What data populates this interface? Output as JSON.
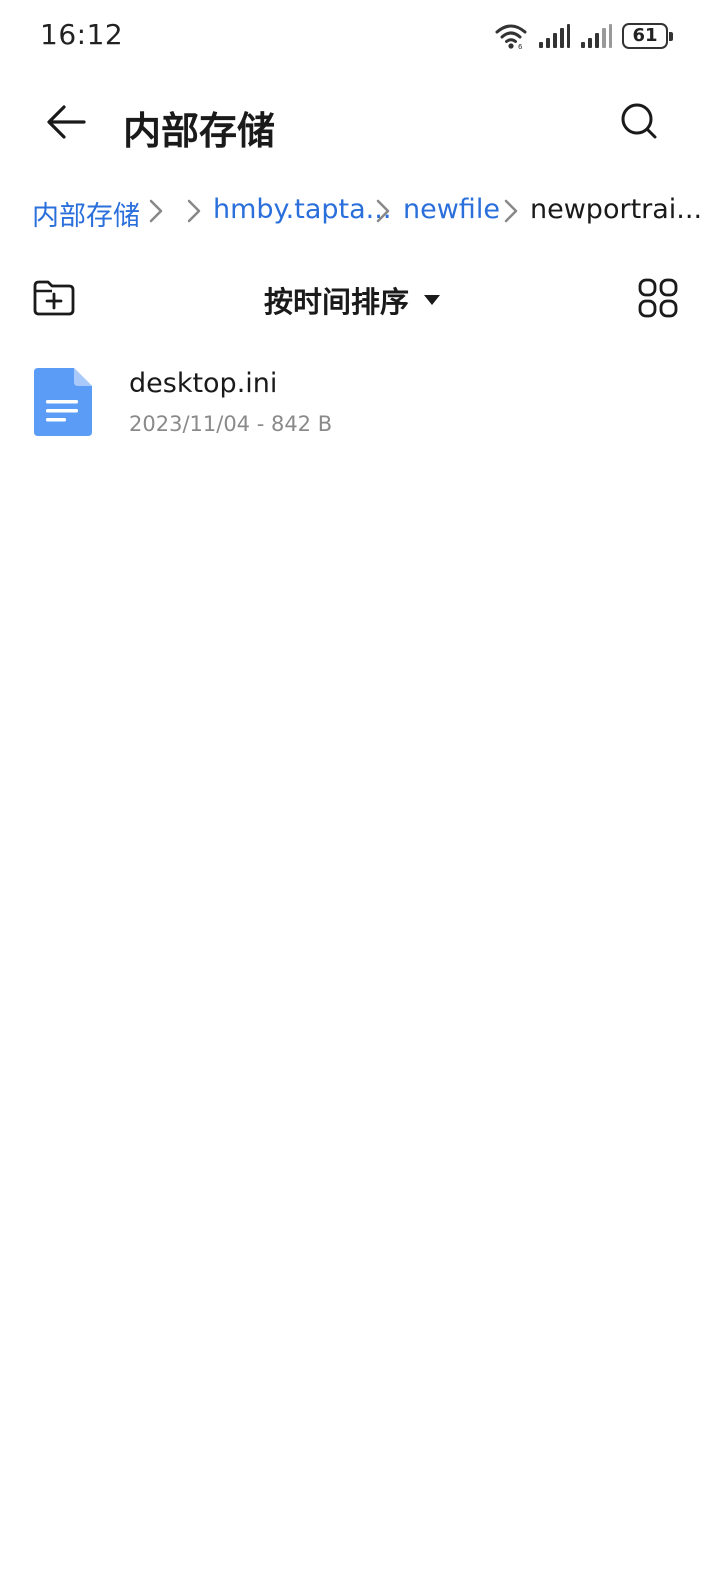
{
  "status_bar": {
    "time": "16:12",
    "battery": "61",
    "icons": [
      "wifi-icon",
      "signal-icon",
      "signal-icon",
      "battery-icon"
    ]
  },
  "header": {
    "title": "内部存储",
    "back_icon": "arrow-left-icon",
    "search_icon": "search-icon"
  },
  "breadcrumb": {
    "items": [
      {
        "label": "内部存储",
        "state": "link"
      },
      {
        "label": "hmby.tapta...",
        "state": "link"
      },
      {
        "label": "newfile",
        "state": "link"
      },
      {
        "label": "newportrai...",
        "state": "current"
      }
    ],
    "separator_icon": "chevron-right-icon",
    "link_color": "#2a6fdb"
  },
  "toolbar": {
    "sort_label": "按时间排序",
    "sort_icon": "triangle-down-icon",
    "new_folder_icon": "folder-plus-icon",
    "view_icon": "grid-view-icon"
  },
  "files": [
    {
      "name": "desktop.ini",
      "meta": "2023/11/04 - 842 B",
      "icon": "document-icon",
      "icon_color": "#5b9cf7"
    }
  ]
}
